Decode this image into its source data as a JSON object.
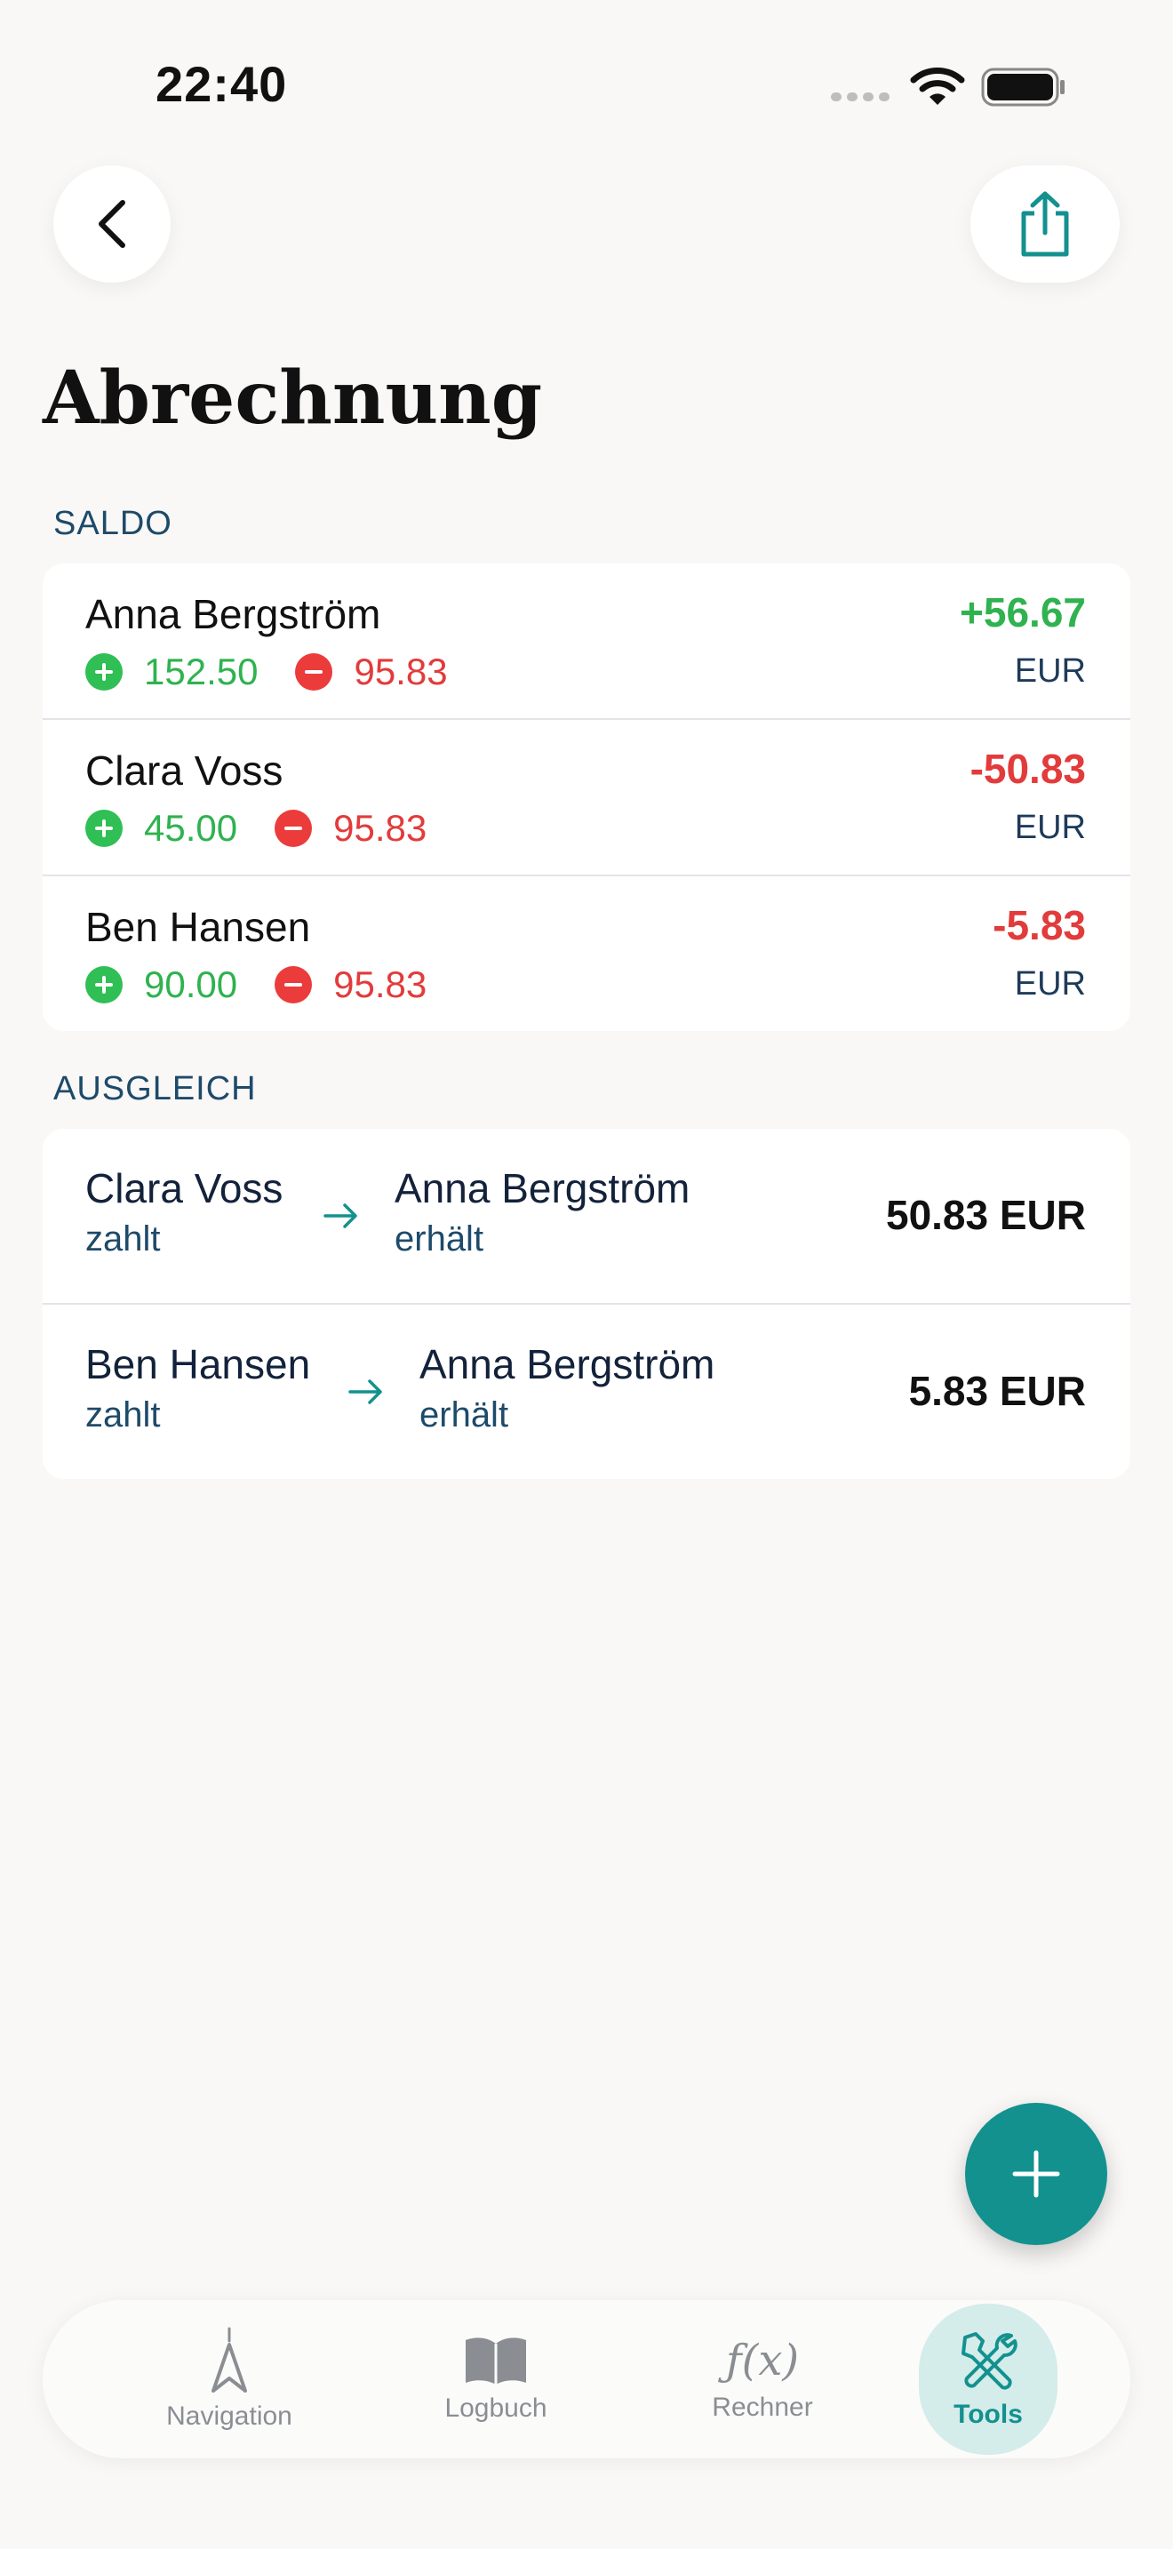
{
  "status_bar": {
    "time": "22:40"
  },
  "page": {
    "title": "Abrechnung"
  },
  "saldo": {
    "label": "SALDO",
    "rows": [
      {
        "name": "Anna Bergström",
        "plus": "152.50",
        "minus": "95.83",
        "amount": "+56.67",
        "currency": "EUR"
      },
      {
        "name": "Clara Voss",
        "plus": "45.00",
        "minus": "95.83",
        "amount": "-50.83",
        "currency": "EUR"
      },
      {
        "name": "Ben Hansen",
        "plus": "90.00",
        "minus": "95.83",
        "amount": "-5.83",
        "currency": "EUR"
      }
    ]
  },
  "ausgleich": {
    "label": "AUSGLEICH",
    "rows": [
      {
        "from": "Clara Voss",
        "from_role": "zahlt",
        "to": "Anna Bergström",
        "to_role": "erhält",
        "amount": "50.83 EUR"
      },
      {
        "from": "Ben Hansen",
        "from_role": "zahlt",
        "to": "Anna Bergström",
        "to_role": "erhält",
        "amount": "5.83 EUR"
      }
    ]
  },
  "tabs": [
    {
      "label": "Navigation",
      "icon": "navigation-icon"
    },
    {
      "label": "Logbuch",
      "icon": "book-icon"
    },
    {
      "label": "Rechner",
      "icon": "function-icon",
      "glyph": "ƒ(x)"
    },
    {
      "label": "Tools",
      "icon": "tools-icon",
      "active": true
    }
  ],
  "colors": {
    "accent": "#13918f",
    "positive": "#2fb24f",
    "negative": "#e23b3b",
    "background": "#f9f8f6"
  }
}
